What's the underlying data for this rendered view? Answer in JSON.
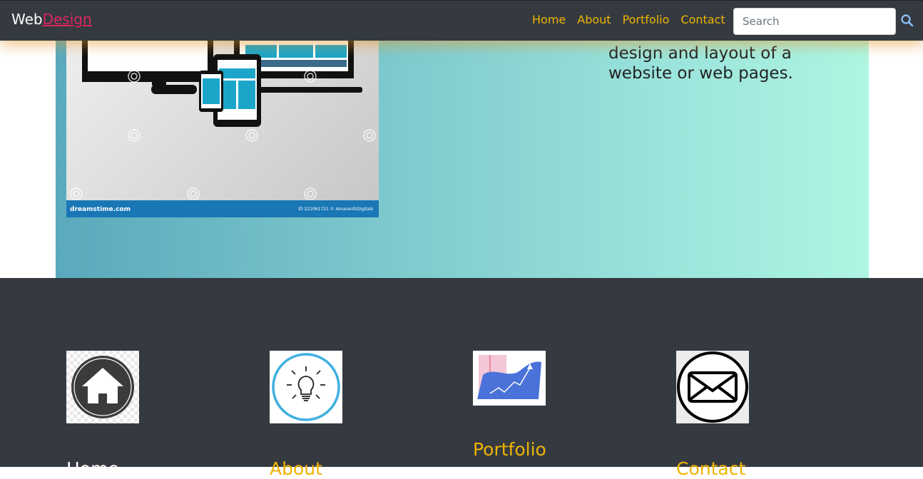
{
  "navbar": {
    "brand_part1": "Web",
    "brand_part2": "Design",
    "links": [
      "Home",
      "About",
      "Portfolio",
      "Contact"
    ],
    "search_placeholder": "Search"
  },
  "hero": {
    "text": "design and layout of a website or web pages.",
    "watermark_left": "dreamstime.com",
    "watermark_right": "ID 221061721 © AmaranthDigitals"
  },
  "cards": [
    {
      "label": "Home",
      "icon": "home-icon"
    },
    {
      "label": "About",
      "icon": "lightbulb-icon"
    },
    {
      "label": "Portfolio",
      "icon": "growth-chart-icon"
    },
    {
      "label": "Contact",
      "icon": "envelope-icon"
    }
  ],
  "colors": {
    "nav_bg": "#343a40",
    "link": "#f0b400",
    "brand_accent": "#e0245e"
  }
}
